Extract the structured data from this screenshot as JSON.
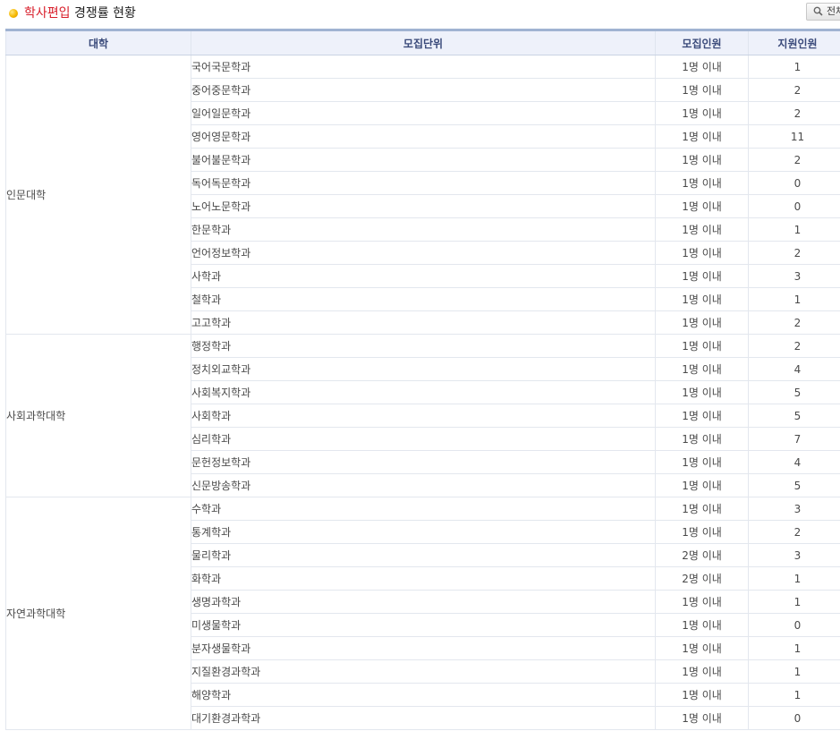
{
  "title": {
    "highlight": "학사편입",
    "rest": " 경쟁률 현황"
  },
  "search_button": {
    "label": "전체",
    "icon": "search-icon"
  },
  "table": {
    "headers": [
      "대학",
      "모집단위",
      "모집인원",
      "지원인원"
    ],
    "groups": [
      {
        "college": "인문대학",
        "rows": [
          {
            "unit": "국어국문학과",
            "quota": "1명 이내",
            "applicants": "1"
          },
          {
            "unit": "중어중문학과",
            "quota": "1명 이내",
            "applicants": "2"
          },
          {
            "unit": "일어일문학과",
            "quota": "1명 이내",
            "applicants": "2"
          },
          {
            "unit": "영어영문학과",
            "quota": "1명 이내",
            "applicants": "11"
          },
          {
            "unit": "불어불문학과",
            "quota": "1명 이내",
            "applicants": "2"
          },
          {
            "unit": "독어독문학과",
            "quota": "1명 이내",
            "applicants": "0"
          },
          {
            "unit": "노어노문학과",
            "quota": "1명 이내",
            "applicants": "0"
          },
          {
            "unit": "한문학과",
            "quota": "1명 이내",
            "applicants": "1"
          },
          {
            "unit": "언어정보학과",
            "quota": "1명 이내",
            "applicants": "2"
          },
          {
            "unit": "사학과",
            "quota": "1명 이내",
            "applicants": "3"
          },
          {
            "unit": "철학과",
            "quota": "1명 이내",
            "applicants": "1"
          },
          {
            "unit": "고고학과",
            "quota": "1명 이내",
            "applicants": "2"
          }
        ]
      },
      {
        "college": "사회과학대학",
        "rows": [
          {
            "unit": "행정학과",
            "quota": "1명 이내",
            "applicants": "2"
          },
          {
            "unit": "정치외교학과",
            "quota": "1명 이내",
            "applicants": "4"
          },
          {
            "unit": "사회복지학과",
            "quota": "1명 이내",
            "applicants": "5"
          },
          {
            "unit": "사회학과",
            "quota": "1명 이내",
            "applicants": "5"
          },
          {
            "unit": "심리학과",
            "quota": "1명 이내",
            "applicants": "7"
          },
          {
            "unit": "문헌정보학과",
            "quota": "1명 이내",
            "applicants": "4"
          },
          {
            "unit": "신문방송학과",
            "quota": "1명 이내",
            "applicants": "5"
          }
        ]
      },
      {
        "college": "자연과학대학",
        "rows": [
          {
            "unit": "수학과",
            "quota": "1명 이내",
            "applicants": "3"
          },
          {
            "unit": "통계학과",
            "quota": "1명 이내",
            "applicants": "2"
          },
          {
            "unit": "물리학과",
            "quota": "2명 이내",
            "applicants": "3"
          },
          {
            "unit": "화학과",
            "quota": "2명 이내",
            "applicants": "1"
          },
          {
            "unit": "생명과학과",
            "quota": "1명 이내",
            "applicants": "1"
          },
          {
            "unit": "미생물학과",
            "quota": "1명 이내",
            "applicants": "0"
          },
          {
            "unit": "분자생물학과",
            "quota": "1명 이내",
            "applicants": "1"
          },
          {
            "unit": "지질환경과학과",
            "quota": "1명 이내",
            "applicants": "1"
          },
          {
            "unit": "해양학과",
            "quota": "1명 이내",
            "applicants": "1"
          },
          {
            "unit": "대기환경과학과",
            "quota": "1명 이내",
            "applicants": "0"
          }
        ]
      }
    ]
  }
}
